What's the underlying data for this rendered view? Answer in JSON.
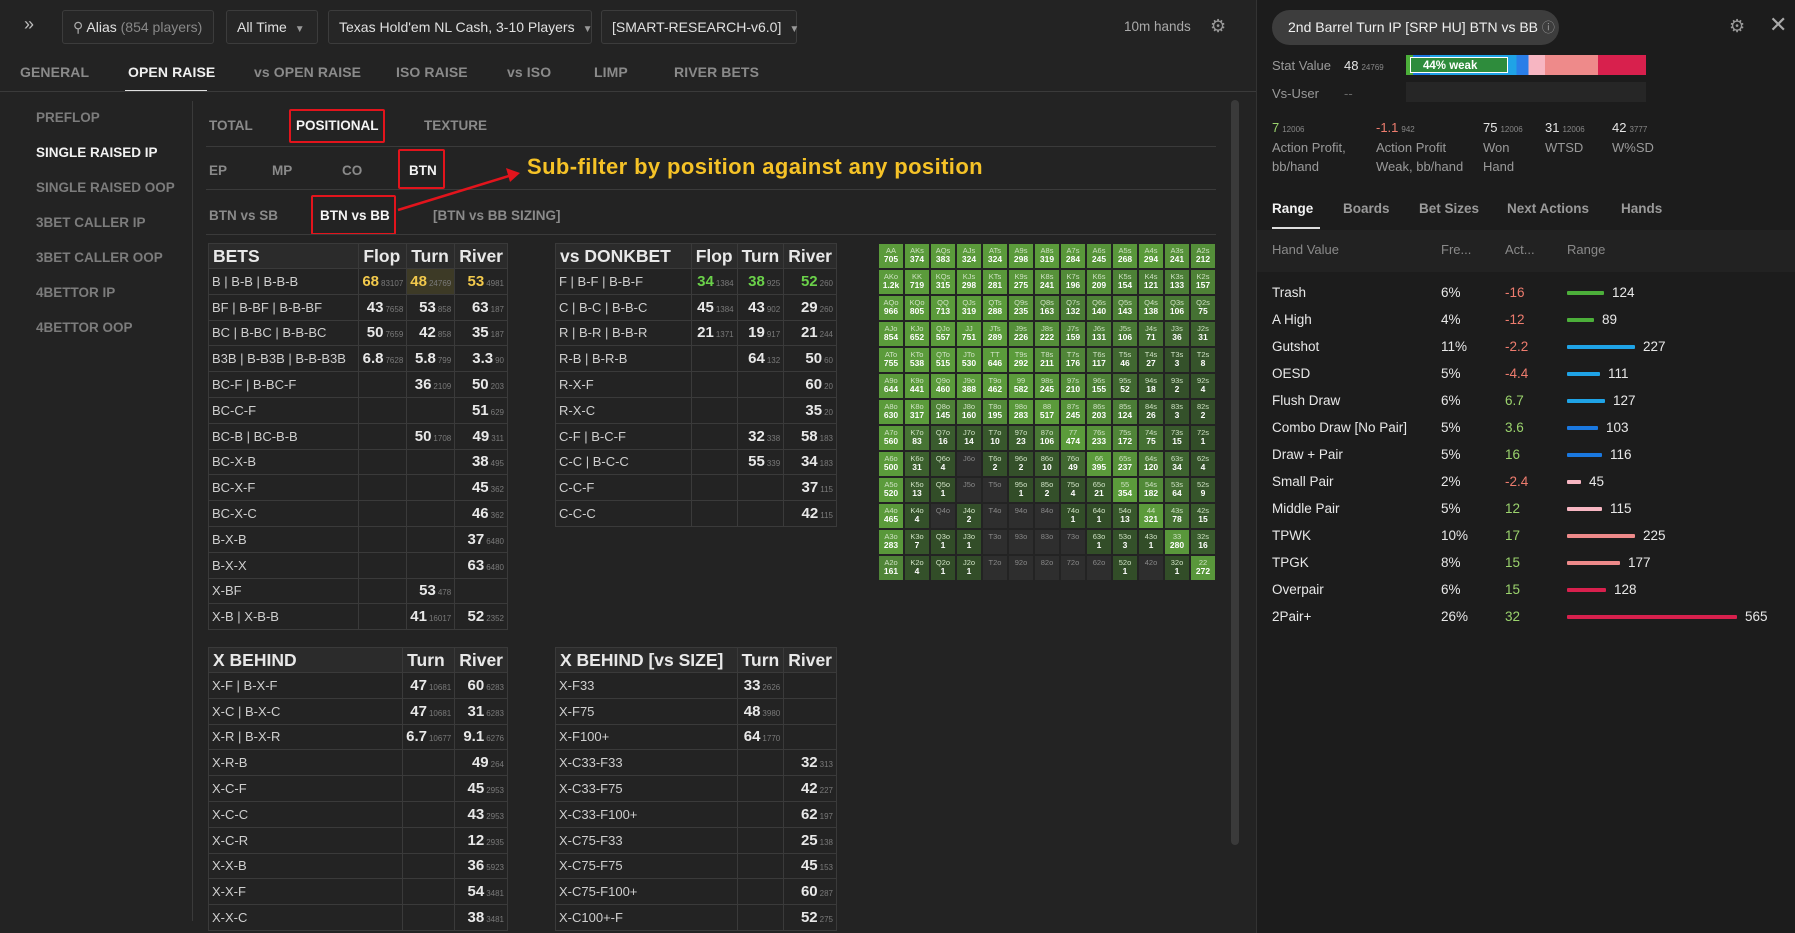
{
  "topbar": {
    "expand_icon": "double-chevron-right-icon",
    "alias": "Alias",
    "alias_count": "(854 players)",
    "time": "All Time",
    "game": "Texas Hold'em NL Cash, 3-10 Players",
    "model": "[SMART-RESEARCH-v6.0]",
    "hands": "10m hands",
    "settings_icon": "gear-icon"
  },
  "main_tabs": [
    "GENERAL",
    "OPEN RAISE",
    "vs OPEN RAISE",
    "ISO RAISE",
    "vs ISO",
    "LIMP",
    "RIVER BETS"
  ],
  "sidebar": [
    "PREFLOP",
    "SINGLE RAISED IP",
    "SINGLE RAISED OOP",
    "3BET CALLER IP",
    "3BET CALLER OOP",
    "4BETTOR IP",
    "4BETTOR OOP"
  ],
  "filter_tabs": [
    "TOTAL",
    "POSITIONAL",
    "TEXTURE"
  ],
  "positions": [
    "EP",
    "MP",
    "CO",
    "BTN"
  ],
  "matchups": [
    "BTN vs SB",
    "BTN vs BB",
    "[BTN vs BB SIZING]"
  ],
  "annotation": "Sub-filter by position against any position",
  "bets_table": {
    "title": "BETS",
    "cols": [
      "Flop",
      "Turn",
      "River"
    ],
    "rows": [
      [
        "B | B-B | B-B-B",
        "68",
        "83107",
        "48",
        "24769",
        "53",
        "4981"
      ],
      [
        "BF | B-BF | B-B-BF",
        "43",
        "7658",
        "53",
        "858",
        "63",
        "187"
      ],
      [
        "BC | B-BC | B-B-BC",
        "50",
        "7659",
        "42",
        "858",
        "35",
        "187"
      ],
      [
        "B3B | B-B3B | B-B-B3B",
        "6.8",
        "7628",
        "5.8",
        "799",
        "3.3",
        "90"
      ],
      [
        "BC-F | B-BC-F",
        "",
        "",
        "36",
        "2109",
        "50",
        "203"
      ],
      [
        "BC-C-F",
        "",
        "",
        "",
        "",
        "51",
        "629"
      ],
      [
        "BC-B | BC-B-B",
        "",
        "",
        "50",
        "1708",
        "49",
        "311"
      ],
      [
        "BC-X-B",
        "",
        "",
        "",
        "",
        "38",
        "495"
      ],
      [
        "BC-X-F",
        "",
        "",
        "",
        "",
        "45",
        "362"
      ],
      [
        "BC-X-C",
        "",
        "",
        "",
        "",
        "46",
        "362"
      ],
      [
        "B-X-B",
        "",
        "",
        "",
        "",
        "37",
        "6480"
      ],
      [
        "B-X-X",
        "",
        "",
        "",
        "",
        "63",
        "6480"
      ],
      [
        "X-BF",
        "",
        "",
        "53",
        "478",
        "",
        ""
      ],
      [
        "X-B | X-B-B",
        "",
        "",
        "41",
        "16017",
        "52",
        "2352"
      ]
    ]
  },
  "donk_table": {
    "title": "vs DONKBET",
    "cols": [
      "Flop",
      "Turn",
      "River"
    ],
    "rows": [
      [
        "F | B-F | B-B-F",
        "34",
        "1384",
        "38",
        "925",
        "52",
        "260"
      ],
      [
        "C | B-C | B-B-C",
        "45",
        "1384",
        "43",
        "902",
        "29",
        "260"
      ],
      [
        "R | B-R | B-B-R",
        "21",
        "1371",
        "19",
        "917",
        "21",
        "244"
      ],
      [
        "R-B | B-R-B",
        "",
        "",
        "64",
        "132",
        "50",
        "60"
      ],
      [
        "R-X-F",
        "",
        "",
        "",
        "",
        "60",
        "20"
      ],
      [
        "R-X-C",
        "",
        "",
        "",
        "",
        "35",
        "20"
      ],
      [
        "C-F | B-C-F",
        "",
        "",
        "32",
        "338",
        "58",
        "183"
      ],
      [
        "C-C | B-C-C",
        "",
        "",
        "55",
        "339",
        "34",
        "183"
      ],
      [
        "C-C-F",
        "",
        "",
        "",
        "",
        "37",
        "115"
      ],
      [
        "C-C-C",
        "",
        "",
        "",
        "",
        "42",
        "115"
      ]
    ]
  },
  "xbehind_table": {
    "title": "X BEHIND",
    "cols": [
      "Turn",
      "River"
    ],
    "rows": [
      [
        "X-F | B-X-F",
        "47",
        "10681",
        "60",
        "6283"
      ],
      [
        "X-C | B-X-C",
        "47",
        "10681",
        "31",
        "6283"
      ],
      [
        "X-R | B-X-R",
        "6.7",
        "10677",
        "9.1",
        "6276"
      ],
      [
        "X-R-B",
        "",
        "",
        "49",
        "264"
      ],
      [
        "X-C-F",
        "",
        "",
        "45",
        "2953"
      ],
      [
        "X-C-C",
        "",
        "",
        "43",
        "2953"
      ],
      [
        "X-C-R",
        "",
        "",
        "12",
        "2935"
      ],
      [
        "X-X-B",
        "",
        "",
        "36",
        "5923"
      ],
      [
        "X-X-F",
        "",
        "",
        "54",
        "3481"
      ],
      [
        "X-X-C",
        "",
        "",
        "38",
        "3481"
      ]
    ]
  },
  "xsize_table": {
    "title": "X BEHIND [vs SIZE]",
    "cols": [
      "Turn",
      "River"
    ],
    "rows": [
      [
        "X-F33",
        "33",
        "2626",
        "",
        ""
      ],
      [
        "X-F75",
        "48",
        "3980",
        "",
        ""
      ],
      [
        "X-F100+",
        "64",
        "1770",
        "",
        ""
      ],
      [
        "X-C33-F33",
        "",
        "",
        "32",
        "313"
      ],
      [
        "X-C33-F75",
        "",
        "",
        "42",
        "227"
      ],
      [
        "X-C33-F100+",
        "",
        "",
        "62",
        "197"
      ],
      [
        "X-C75-F33",
        "",
        "",
        "25",
        "138"
      ],
      [
        "X-C75-F75",
        "",
        "",
        "45",
        "153"
      ],
      [
        "X-C75-F100+",
        "",
        "",
        "60",
        "287"
      ],
      [
        "X-C100+-F",
        "",
        "",
        "52",
        "275"
      ]
    ]
  },
  "hand_grid": [
    [
      "AA 705",
      "AKs 374",
      "AQs 383",
      "AJs 324",
      "ATs 324",
      "A9s 298",
      "A8s 319",
      "A7s 284",
      "A6s 245",
      "A5s 268",
      "A4s 294",
      "A3s 241",
      "A2s 212"
    ],
    [
      "AKo 1.2k",
      "KK 719",
      "KQs 315",
      "KJs 298",
      "KTs 281",
      "K9s 275",
      "K8s 241",
      "K7s 196",
      "K6s 209",
      "K5s 154",
      "K4s 121",
      "K3s 133",
      "K2s 157"
    ],
    [
      "AQo 966",
      "KQo 805",
      "QQ 713",
      "QJs 319",
      "QTs 288",
      "Q9s 235",
      "Q8s 163",
      "Q7s 132",
      "Q6s 140",
      "Q5s 143",
      "Q4s 138",
      "Q3s 106",
      "Q2s 75"
    ],
    [
      "AJo 854",
      "KJo 652",
      "QJo 557",
      "JJ 751",
      "JTs 289",
      "J9s 226",
      "J8s 222",
      "J7s 159",
      "J6s 131",
      "J5s 106",
      "J4s 71",
      "J3s 36",
      "J2s 31"
    ],
    [
      "ATo 755",
      "KTo 538",
      "QTo 515",
      "JTo 530",
      "TT 646",
      "T9s 292",
      "T8s 211",
      "T7s 176",
      "T6s 117",
      "T5s 46",
      "T4s 27",
      "T3s 3",
      "T2s 8"
    ],
    [
      "A9o 644",
      "K9o 441",
      "Q9o 460",
      "J9o 388",
      "T9o 462",
      "99 582",
      "98s 245",
      "97s 210",
      "96s 155",
      "95s 52",
      "94s 18",
      "93s 2",
      "92s 4"
    ],
    [
      "A8o 630",
      "K8o 317",
      "Q8o 145",
      "J8o 160",
      "T8o 195",
      "98o 283",
      "88 517",
      "87s 245",
      "86s 203",
      "85s 124",
      "84s 26",
      "83s 3",
      "82s 2"
    ],
    [
      "A7o 560",
      "K7o 83",
      "Q7o 16",
      "J7o 14",
      "T7o 10",
      "97o 23",
      "87o 106",
      "77 474",
      "76s 233",
      "75s 172",
      "74s 75",
      "73s 15",
      "72s 1"
    ],
    [
      "A6o 500",
      "K6o 31",
      "Q6o 4",
      "J6o",
      "T6o 2",
      "96o 2",
      "86o 10",
      "76o 49",
      "66 395",
      "65s 237",
      "64s 120",
      "63s 34",
      "62s 4"
    ],
    [
      "A5o 520",
      "K5o 13",
      "Q5o 1",
      "J5o",
      "T5o",
      "95o 1",
      "85o 2",
      "75o 4",
      "65o 21",
      "55 354",
      "54s 182",
      "53s 64",
      "52s 9"
    ],
    [
      "A4o 465",
      "K4o 4",
      "Q4o",
      "J4o 2",
      "T4o",
      "94o",
      "84o",
      "74o 1",
      "64o 1",
      "54o 13",
      "44 321",
      "43s 78",
      "42s 15"
    ],
    [
      "A3o 283",
      "K3o 7",
      "Q3o 1",
      "J3o 1",
      "T3o",
      "93o",
      "83o",
      "73o",
      "63o 1",
      "53o 3",
      "43o 1",
      "33 280",
      "32s 16"
    ],
    [
      "A2o 161",
      "K2o 4",
      "Q2o 1",
      "J2o 1",
      "T2o",
      "92o",
      "82o",
      "72o",
      "62o",
      "52o 1",
      "42o",
      "32o 1",
      "22 272"
    ]
  ],
  "right": {
    "title": "2nd Barrel Turn IP [SRP HU] BTN vs BB",
    "info_icon": "info-circle-icon",
    "settings_icon": "gear-icon",
    "close_icon": "close-icon",
    "stat_label": "Stat Value",
    "stat_value": "48",
    "stat_count": "24769",
    "stat_bar_text": "44% weak",
    "vsuser_label": "Vs-User",
    "vsuser_value": "--",
    "metrics": [
      {
        "v": "7",
        "n": "12006",
        "l1": "Action Profit,",
        "l2": "bb/hand",
        "color": "#9bd36d"
      },
      {
        "v": "-1.1",
        "n": "942",
        "l1": "Action Profit",
        "l2": "Weak, bb/hand",
        "color": "#ee7c6e"
      },
      {
        "v": "75",
        "n": "12006",
        "l1": "Won",
        "l2": "Hand",
        "color": "#e5e5e5"
      },
      {
        "v": "31",
        "n": "12006",
        "l1": "WTSD",
        "l2": "",
        "color": "#e5e5e5"
      },
      {
        "v": "42",
        "n": "3777",
        "l1": "W%SD",
        "l2": "",
        "color": "#e5e5e5"
      }
    ],
    "tabs": [
      "Range",
      "Boards",
      "Bet Sizes",
      "Next Actions",
      "Hands"
    ],
    "headers": [
      "Hand Value",
      "Fre...",
      "Act...",
      "Range"
    ],
    "rows": [
      {
        "name": "Trash",
        "freq": "6%",
        "act": "-16",
        "count": "124",
        "range": 124,
        "color": "#4caf3a"
      },
      {
        "name": "A High",
        "freq": "4%",
        "act": "-12",
        "count": "89",
        "range": 89,
        "color": "#4caf3a"
      },
      {
        "name": "Gutshot",
        "freq": "11%",
        "act": "-2.2",
        "count": "227",
        "range": 227,
        "color": "#1fa3e6"
      },
      {
        "name": "OESD",
        "freq": "5%",
        "act": "-4.4",
        "count": "111",
        "range": 111,
        "color": "#1fa3e6"
      },
      {
        "name": "Flush Draw",
        "freq": "6%",
        "act": "6.7",
        "count": "127",
        "range": 127,
        "color": "#1fa3e6"
      },
      {
        "name": "Combo Draw [No Pair]",
        "freq": "5%",
        "act": "3.6",
        "count": "103",
        "range": 103,
        "color": "#1a78e0"
      },
      {
        "name": "Draw + Pair",
        "freq": "5%",
        "act": "16",
        "count": "116",
        "range": 116,
        "color": "#1a78e0"
      },
      {
        "name": "Small Pair",
        "freq": "2%",
        "act": "-2.4",
        "count": "45",
        "range": 45,
        "color": "#f7b6c2"
      },
      {
        "name": "Middle Pair",
        "freq": "5%",
        "act": "12",
        "count": "115",
        "range": 115,
        "color": "#f7b6c2"
      },
      {
        "name": "TPWK",
        "freq": "10%",
        "act": "17",
        "count": "225",
        "range": 225,
        "color": "#ee8a8a"
      },
      {
        "name": "TPGK",
        "freq": "8%",
        "act": "15",
        "count": "177",
        "range": 177,
        "color": "#ee8a8a"
      },
      {
        "name": "Overpair",
        "freq": "6%",
        "act": "15",
        "count": "128",
        "range": 128,
        "color": "#d8204d"
      },
      {
        "name": "2Pair+",
        "freq": "26%",
        "act": "32",
        "count": "565",
        "range": 565,
        "color": "#d8204d"
      }
    ]
  }
}
